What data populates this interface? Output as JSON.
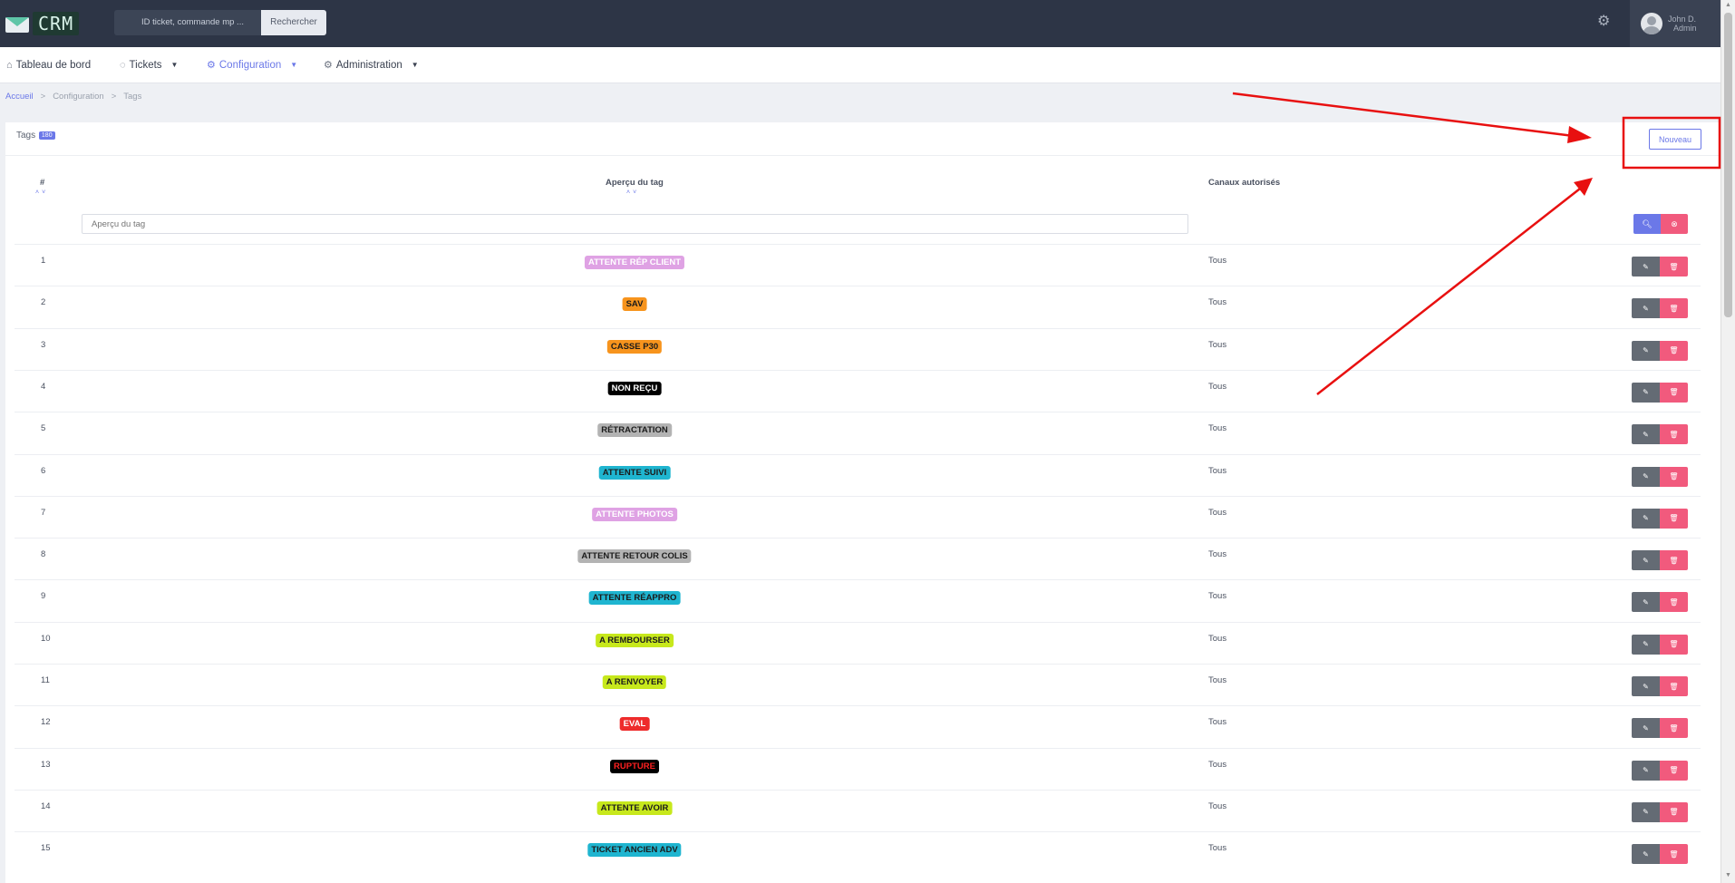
{
  "app": {
    "logo_text": "CRM"
  },
  "header": {
    "search_placeholder": "ID ticket, commande mp ...",
    "search_button": "Rechercher",
    "user_name": "John D.",
    "user_role": "Admin"
  },
  "nav": [
    {
      "label": "Tableau de bord",
      "icon": "home-icon",
      "dropdown": false,
      "active": false
    },
    {
      "label": "Tickets",
      "icon": "chat-icon",
      "dropdown": true,
      "active": false
    },
    {
      "label": "Configuration",
      "icon": "gear-icon",
      "dropdown": true,
      "active": true
    },
    {
      "label": "Administration",
      "icon": "gear-icon",
      "dropdown": true,
      "active": false
    }
  ],
  "breadcrumb": [
    "Accueil",
    "Configuration",
    "Tags"
  ],
  "card": {
    "title": "Tags",
    "count": "180",
    "new_button": "Nouveau"
  },
  "table": {
    "headers": {
      "num": "#",
      "preview": "Aperçu du tag",
      "channels": "Canaux autorisés"
    },
    "filter_placeholder": "Aperçu du tag",
    "rows": [
      {
        "num": "1",
        "tag": "ATTENTE RÉP CLIENT",
        "bg": "#dfa2e4",
        "fg": "#ffffff",
        "channels": "Tous"
      },
      {
        "num": "2",
        "tag": "SAV",
        "bg": "#f7941d",
        "fg": "#1b1b1b",
        "channels": "Tous"
      },
      {
        "num": "3",
        "tag": "CASSE P30",
        "bg": "#f7941d",
        "fg": "#1b1b1b",
        "channels": "Tous"
      },
      {
        "num": "4",
        "tag": "NON REÇU",
        "bg": "#000000",
        "fg": "#ffffff",
        "channels": "Tous"
      },
      {
        "num": "5",
        "tag": "RÉTRACTATION",
        "bg": "#b3b3b3",
        "fg": "#1b1b1b",
        "channels": "Tous"
      },
      {
        "num": "6",
        "tag": "ATTENTE SUIVI",
        "bg": "#1fb5d0",
        "fg": "#1b1b1b",
        "channels": "Tous"
      },
      {
        "num": "7",
        "tag": "ATTENTE PHOTOS",
        "bg": "#dfa2e4",
        "fg": "#ffffff",
        "channels": "Tous"
      },
      {
        "num": "8",
        "tag": "ATTENTE RETOUR COLIS",
        "bg": "#b3b3b3",
        "fg": "#1b1b1b",
        "channels": "Tous"
      },
      {
        "num": "9",
        "tag": "ATTENTE RÉAPPRO",
        "bg": "#1fb5d0",
        "fg": "#1b1b1b",
        "channels": "Tous"
      },
      {
        "num": "10",
        "tag": "A REMBOURSER",
        "bg": "#c7e81c",
        "fg": "#1b1b1b",
        "channels": "Tous"
      },
      {
        "num": "11",
        "tag": "A RENVOYER",
        "bg": "#c7e81c",
        "fg": "#1b1b1b",
        "channels": "Tous"
      },
      {
        "num": "12",
        "tag": "EVAL",
        "bg": "#ee2b2b",
        "fg": "#ffffff",
        "channels": "Tous"
      },
      {
        "num": "13",
        "tag": "RUPTURE",
        "bg": "#000000",
        "fg": "#ff2020",
        "channels": "Tous"
      },
      {
        "num": "14",
        "tag": "ATTENTE AVOIR",
        "bg": "#c7e81c",
        "fg": "#1b1b1b",
        "channels": "Tous"
      },
      {
        "num": "15",
        "tag": "TICKET ANCIEN ADV",
        "bg": "#1fb5d0",
        "fg": "#1b1b1b",
        "channels": "Tous"
      }
    ]
  },
  "colors": {
    "accent": "#6b78e8",
    "danger": "#f15a7d",
    "annotation": "#e81010"
  }
}
